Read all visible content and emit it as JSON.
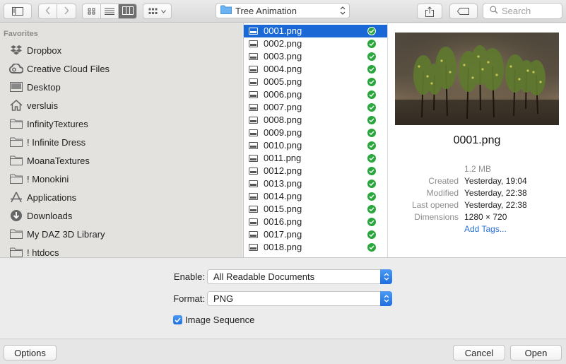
{
  "toolbar": {
    "path_label": "Tree Animation",
    "search_placeholder": "Search",
    "view_modes": [
      "icons",
      "list",
      "columns"
    ],
    "active_view": "columns"
  },
  "sidebar": {
    "heading": "Favorites",
    "items": [
      {
        "label": "Dropbox",
        "icon": "dropbox-icon"
      },
      {
        "label": "Creative Cloud Files",
        "icon": "creative-cloud-icon"
      },
      {
        "label": "Desktop",
        "icon": "desktop-icon"
      },
      {
        "label": "versluis",
        "icon": "home-icon"
      },
      {
        "label": "InfinityTextures",
        "icon": "folder-icon"
      },
      {
        "label": "! Infinite Dress",
        "icon": "folder-icon"
      },
      {
        "label": "MoanaTextures",
        "icon": "folder-icon"
      },
      {
        "label": "! Monokini",
        "icon": "folder-icon"
      },
      {
        "label": "Applications",
        "icon": "applications-icon"
      },
      {
        "label": "Downloads",
        "icon": "downloads-icon"
      },
      {
        "label": "My DAZ 3D Library",
        "icon": "folder-icon"
      },
      {
        "label": "! htdocs",
        "icon": "folder-icon"
      }
    ]
  },
  "files": [
    "0001.png",
    "0002.png",
    "0003.png",
    "0004.png",
    "0005.png",
    "0006.png",
    "0007.png",
    "0008.png",
    "0009.png",
    "0010.png",
    "0011.png",
    "0012.png",
    "0013.png",
    "0014.png",
    "0015.png",
    "0016.png",
    "0017.png",
    "0018.png"
  ],
  "selected_file": "0001.png",
  "preview": {
    "name": "0001.png",
    "size": "1.2 MB",
    "meta": [
      {
        "key": "Created",
        "value": "Yesterday, 19:04"
      },
      {
        "key": "Modified",
        "value": "Yesterday, 22:38"
      },
      {
        "key": "Last opened",
        "value": "Yesterday, 22:38"
      },
      {
        "key": "Dimensions",
        "value": "1280 × 720"
      }
    ],
    "add_tags": "Add Tags..."
  },
  "options": {
    "enable_label": "Enable:",
    "enable_value": "All Readable Documents",
    "format_label": "Format:",
    "format_value": "PNG",
    "image_sequence_label": "Image Sequence",
    "image_sequence_checked": true
  },
  "buttons": {
    "options": "Options",
    "cancel": "Cancel",
    "open": "Open"
  },
  "colors": {
    "accent": "#1a68d6",
    "check_green": "#29a73c",
    "link": "#2a72d8"
  }
}
